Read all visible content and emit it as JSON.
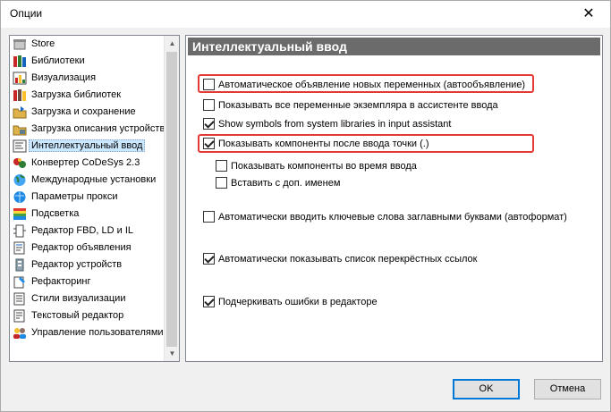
{
  "window": {
    "title": "Опции",
    "close_glyph": "✕"
  },
  "tree": {
    "items": [
      {
        "label": "Store",
        "icon": "store-icon"
      },
      {
        "label": "Библиотеки",
        "icon": "library-books-icon"
      },
      {
        "label": "Визуализация",
        "icon": "visualization-icon"
      },
      {
        "label": "Загрузка библиотек",
        "icon": "library-download-icon"
      },
      {
        "label": "Загрузка и сохранение",
        "icon": "load-save-folder-icon"
      },
      {
        "label": "Загрузка описания устройств",
        "icon": "device-description-icon"
      },
      {
        "label": "Интеллектуальный ввод",
        "icon": "smart-input-icon",
        "selected": true
      },
      {
        "label": "Конвертер CoDeSys 2.3",
        "icon": "converter-icon"
      },
      {
        "label": "Международные установки",
        "icon": "globe-icon"
      },
      {
        "label": "Параметры прокси",
        "icon": "proxy-globe-icon"
      },
      {
        "label": "Подсветка",
        "icon": "highlight-icon"
      },
      {
        "label": "Редактор FBD, LD и IL",
        "icon": "fbd-editor-icon"
      },
      {
        "label": "Редактор объявления",
        "icon": "declaration-editor-icon"
      },
      {
        "label": "Редактор устройств",
        "icon": "device-editor-icon"
      },
      {
        "label": "Рефакторинг",
        "icon": "refactoring-icon"
      },
      {
        "label": "Стили визуализации",
        "icon": "visualization-styles-icon"
      },
      {
        "label": "Текстовый редактор",
        "icon": "text-editor-icon"
      },
      {
        "label": "Управление пользователями",
        "icon": "users-icon"
      }
    ]
  },
  "panel": {
    "title": "Интеллектуальный ввод",
    "options": [
      {
        "label": "Автоматическое объявление новых переменных (автообъявление)",
        "checked": false
      },
      {
        "label": "Показывать все переменные экземпляра в ассистенте ввода",
        "checked": false
      },
      {
        "label": "Show symbols from system libraries in input assistant",
        "checked": true
      },
      {
        "label": "Показывать компоненты после ввода точки (.)",
        "checked": true
      },
      {
        "label": "Показывать компоненты во время ввода",
        "checked": false
      },
      {
        "label": "Вставить с доп. именем",
        "checked": false
      },
      {
        "label": "Автоматически вводить ключевые слова заглавными буквами (автоформат)",
        "checked": false
      },
      {
        "label": "Автоматически показывать список перекрёстных ссылок",
        "checked": true
      },
      {
        "label": "Подчеркивать ошибки в редакторе",
        "checked": true
      }
    ]
  },
  "buttons": {
    "ok": "OK",
    "cancel": "Отмена"
  },
  "colors": {
    "highlight": "#e53935",
    "selection": "#cce8ff",
    "header_bg": "#6b6b6b"
  }
}
